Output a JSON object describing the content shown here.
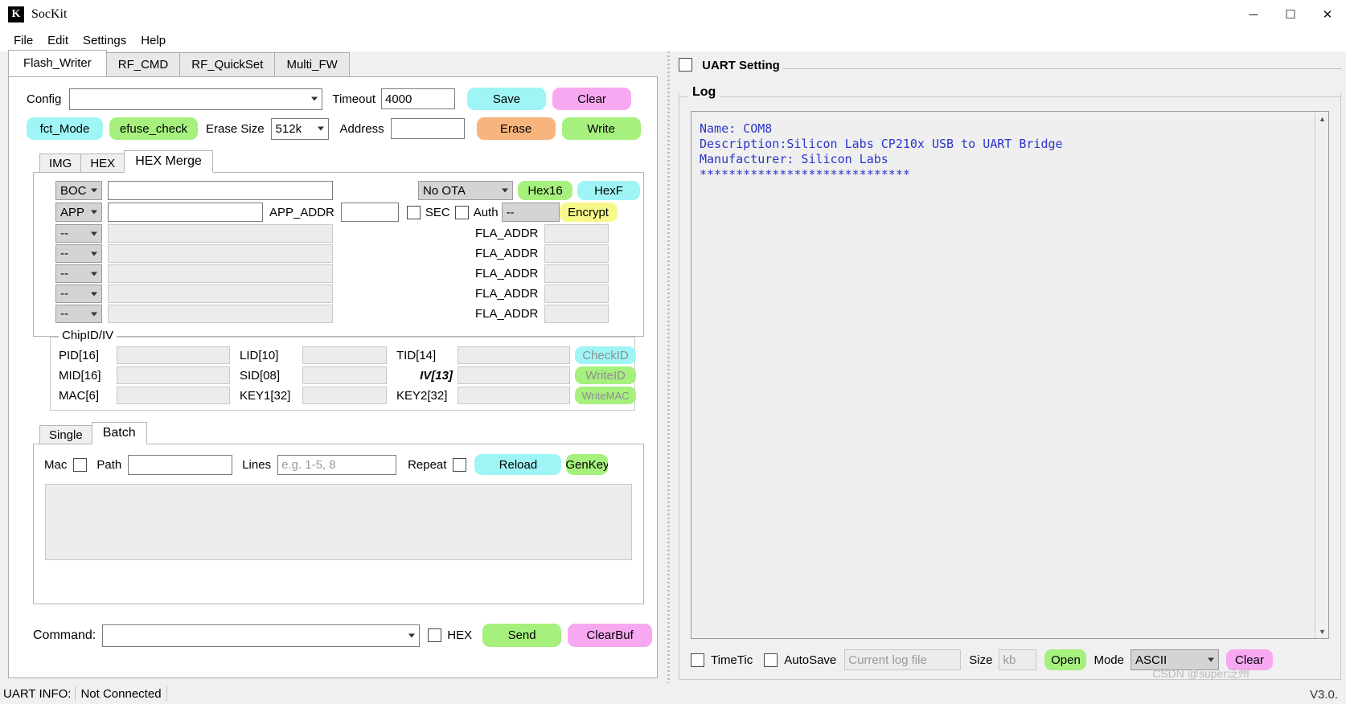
{
  "window": {
    "title": "SocKit",
    "icon_letter": "K",
    "minimize": "─",
    "maximize": "☐",
    "close": "✕"
  },
  "menu": [
    "File",
    "Edit",
    "Settings",
    "Help"
  ],
  "tabs": [
    {
      "label": "Flash_Writer",
      "active": true
    },
    {
      "label": "RF_CMD",
      "active": false
    },
    {
      "label": "RF_QuickSet",
      "active": false
    },
    {
      "label": "Multi_FW",
      "active": false
    }
  ],
  "config_row": {
    "config_label": "Config",
    "config_value": "",
    "timeout_label": "Timeout",
    "timeout_value": "4000",
    "save_label": "Save",
    "clear_label": "Clear",
    "save_color": "#9ff5f5",
    "clear_color": "#f7a8f0"
  },
  "erase_row": {
    "fct_mode_label": "fct_Mode",
    "fct_mode_color": "#9ff5f5",
    "efuse_check_label": "efuse_check",
    "efuse_check_color": "#a6f07e",
    "erase_size_label": "Erase Size",
    "erase_size_value": "512k",
    "address_label": "Address",
    "address_value": "",
    "erase_label": "Erase",
    "erase_color": "#f7b47c",
    "write_label": "Write",
    "write_color": "#a6f07e"
  },
  "inner_tabs": [
    {
      "label": "IMG",
      "active": false
    },
    {
      "label": "HEX",
      "active": false
    },
    {
      "label": "HEX Merge",
      "active": true
    }
  ],
  "merge": {
    "ota_value": "No OTA",
    "hex16_label": "Hex16",
    "hex16_color": "#a6f07e",
    "hexf_label": "HexF",
    "hexf_color": "#9ff5f5",
    "encrypt_label": "Encrypt",
    "encrypt_color": "#f7f78a",
    "sec_label": "SEC",
    "auth_label": "Auth",
    "auth_value": "--",
    "app_addr_label": "APP_ADDR",
    "app_addr_value": "",
    "fla_addr_label": "FLA_ADDR",
    "rows": [
      {
        "type": "BOC",
        "path": "",
        "disabled": false
      },
      {
        "type": "APP",
        "path": "",
        "disabled": false
      },
      {
        "type": "--",
        "path": "",
        "disabled": true
      },
      {
        "type": "--",
        "path": "",
        "disabled": true
      },
      {
        "type": "--",
        "path": "",
        "disabled": true
      },
      {
        "type": "--",
        "path": "",
        "disabled": true
      },
      {
        "type": "--",
        "path": "",
        "disabled": true
      }
    ]
  },
  "chipid": {
    "legend": "ChipID/IV",
    "fields": [
      {
        "label": "PID[16]",
        "value": ""
      },
      {
        "label": "LID[10]",
        "value": ""
      },
      {
        "label": "TID[14]",
        "value": ""
      },
      {
        "label": "MID[16]",
        "value": ""
      },
      {
        "label": "SID[08]",
        "value": ""
      },
      {
        "label": "IV[13]",
        "value": ""
      },
      {
        "label": "MAC[6]",
        "value": ""
      },
      {
        "label": "KEY1[32]",
        "value": ""
      },
      {
        "label": "KEY2[32]",
        "value": ""
      }
    ],
    "buttons": [
      {
        "label": "CheckID",
        "color": "#9ff5f5"
      },
      {
        "label": "WriteID",
        "color": "#a6f07e"
      },
      {
        "label": "WriteMAC",
        "color": "#a6f07e"
      }
    ]
  },
  "mode_tabs": [
    {
      "label": "Single",
      "active": false
    },
    {
      "label": "Batch",
      "active": true
    }
  ],
  "batch": {
    "mac_label": "Mac",
    "path_label": "Path",
    "path_value": "",
    "lines_label": "Lines",
    "lines_placeholder": "e.g. 1-5, 8",
    "lines_value": "",
    "repeat_label": "Repeat",
    "reload_label": "Reload",
    "reload_color": "#9ff5f5",
    "genkey_label": "GenKey",
    "genkey_color": "#a6f07e",
    "textarea_value": ""
  },
  "command_row": {
    "label": "Command:",
    "value": "",
    "hex_label": "HEX",
    "send_label": "Send",
    "send_color": "#a6f07e",
    "clearbuf_label": "ClearBuf",
    "clearbuf_color": "#f7a8f0"
  },
  "right": {
    "uart_setting_label": "UART Setting",
    "log_legend": "Log",
    "log_text": "Name: COM8\nDescription:Silicon Labs CP210x USB to UART Bridge\nManufacturer: Silicon Labs\n*****************************",
    "toolbar": {
      "timetic_label": "TimeTic",
      "autosave_label": "AutoSave",
      "logfile_placeholder": "Current log file",
      "logfile_value": "",
      "size_label": "Size",
      "size_placeholder": "kb",
      "size_value": "",
      "open_label": "Open",
      "open_color": "#a6f07e",
      "mode_label": "Mode",
      "mode_value": "ASCII",
      "clear_label": "Clear",
      "clear_color": "#f7a8f0"
    }
  },
  "statusbar": {
    "uart_info_label": "UART INFO:",
    "uart_info_value": "Not Connected",
    "watermark": "CSDN @super泛州",
    "version": "V3.0."
  }
}
